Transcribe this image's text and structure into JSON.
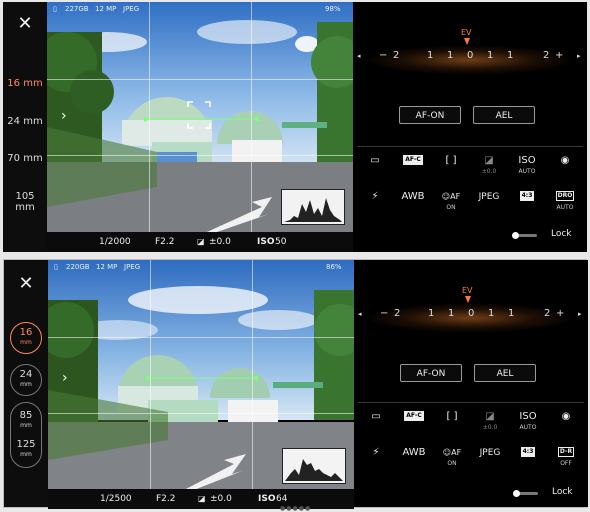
{
  "screenshots": [
    {
      "status": {
        "storage": "227GB",
        "megapixels": "12 MP",
        "format": "JPEG",
        "battery": "98%"
      },
      "zoom": [
        {
          "value": "16",
          "unit": "mm",
          "label": "16 mm",
          "active": true
        },
        {
          "value": "24",
          "unit": "mm",
          "label": "24 mm",
          "active": false
        },
        {
          "value": "70",
          "unit": "mm",
          "label": "70 mm",
          "active": false
        },
        {
          "value": "105",
          "unit": "mm",
          "label": "105 mm",
          "active": false
        }
      ],
      "exposure": {
        "shutter": "1/2000",
        "aperture": "F2.2",
        "ev_comp": "±0.0",
        "iso_label": "ISO",
        "iso_value": "50"
      }
    },
    {
      "status": {
        "storage": "220GB",
        "megapixels": "12 MP",
        "format": "JPEG",
        "battery": "86%"
      },
      "zoom": [
        {
          "value": "16",
          "unit": "mm",
          "active": true
        },
        {
          "value": "24",
          "unit": "mm",
          "active": false
        },
        {
          "value": "85",
          "unit": "mm",
          "active": false
        },
        {
          "value": "125",
          "unit": "mm",
          "active": false
        }
      ],
      "exposure": {
        "shutter": "1/2500",
        "aperture": "F2.2",
        "ev_comp": "±0.0",
        "iso_label": "ISO",
        "iso_value": "64"
      }
    }
  ],
  "panel": {
    "ev_label": "EV",
    "ev_scale": [
      "−",
      "2",
      "1",
      "1",
      "0",
      "1",
      "1",
      "2",
      "+"
    ],
    "af_on_button": "AF-ON",
    "ael_button": "AEL",
    "row1": [
      {
        "glyph": "▭",
        "sub": ""
      },
      {
        "glyph": "AF-C",
        "sub": ""
      },
      {
        "glyph": "[ ]",
        "sub": ""
      },
      {
        "glyph": "◪",
        "sub": "±0.0"
      },
      {
        "glyph": "ISO",
        "sub": "AUTO"
      },
      {
        "glyph": "◉",
        "sub": ""
      }
    ],
    "row2_a": [
      {
        "glyph": "⚡",
        "sub": ""
      },
      {
        "glyph": "AWB",
        "sub": ""
      },
      {
        "glyph": "☺AF",
        "sub": "ON"
      },
      {
        "glyph": "JPEG",
        "sub": ""
      },
      {
        "glyph": "4:3",
        "sub": ""
      },
      {
        "glyph": "DRO",
        "sub": "AUTO"
      }
    ],
    "row2_b": [
      {
        "glyph": "⚡",
        "sub": ""
      },
      {
        "glyph": "AWB",
        "sub": ""
      },
      {
        "glyph": "☺AF",
        "sub": "ON"
      },
      {
        "glyph": "JPEG",
        "sub": ""
      },
      {
        "glyph": "4:3",
        "sub": ""
      },
      {
        "glyph": "D-R",
        "sub": "OFF"
      }
    ],
    "lock_label": "Lock"
  },
  "colors": {
    "accent": "#ff8a5c",
    "ev_marker": "#ff7a3c",
    "background": "#000000"
  },
  "icons": {
    "close": "close-icon",
    "expand": "chevron-right-icon",
    "flash": "flash-icon"
  }
}
